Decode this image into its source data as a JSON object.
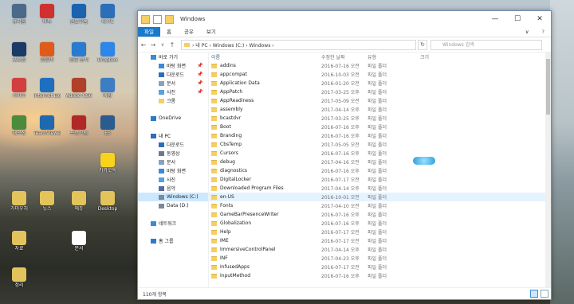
{
  "desktop": {
    "icons": [
      {
        "label": "휴지통",
        "color": "#4a6a8a"
      },
      {
        "label": "바둑",
        "color": "#d03030"
      },
      {
        "label": "윈도우홈",
        "color": "#1a63b0"
      },
      {
        "label": "내 PC",
        "color": "#2a6fb8"
      },
      {
        "label": "포토샵",
        "color": "#1b3b67"
      },
      {
        "label": "알툴바",
        "color": "#e05a1c"
      },
      {
        "label": "한글 문서",
        "color": "#2a7bd0"
      },
      {
        "label": "Dropbox",
        "color": "#2d86e8"
      },
      {
        "label": "카카오",
        "color": "#d23f3f"
      },
      {
        "label": "Internet Explorer",
        "color": "#1f6fc0"
      },
      {
        "label": "Adobe CS6",
        "color": "#b0402a"
      },
      {
        "label": "바탕",
        "color": "#3c7ec3"
      },
      {
        "label": "메모장",
        "color": "#4b8b3b"
      },
      {
        "label": "TeamViewer",
        "color": "#1f69b1"
      },
      {
        "label": "프로그램",
        "color": "#b02828"
      },
      {
        "label": "ES",
        "color": "#2a5c90"
      },
      {
        "label": "카카오톡",
        "color": "#f7d31d"
      },
      {
        "label": "가미우치",
        "color": "#e3c35c"
      },
      {
        "label": "뉴스",
        "color": "#e3c35c"
      },
      {
        "label": "에듀",
        "color": "#e3c35c"
      },
      {
        "label": "Desktop",
        "color": "#e3c35c"
      },
      {
        "label": "자료",
        "color": "#e3c35c"
      },
      {
        "label": "문서",
        "color": "#ffffff"
      },
      {
        "label": "정리",
        "color": "#e3c35c"
      }
    ]
  },
  "window": {
    "title": "Windows",
    "minimize_label": "—",
    "maximize_label": "☐",
    "close_label": "✕",
    "ribbon_tabs": [
      "파일",
      "홈",
      "공유",
      "보기"
    ],
    "expand_ribbon": "∨",
    "help": "?",
    "nav": {
      "back": "←",
      "forward": "→",
      "up": "↑",
      "recent": "∨"
    },
    "address_path": "›  내 PC  ›  Windows (C:)  ›  Windows  ›",
    "refresh": "↻",
    "search_placeholder": "Windows 검색",
    "navpane": {
      "items": [
        {
          "label": "바로 가기",
          "indent": 2,
          "pin": false,
          "icon": "#3a8ad6",
          "sel": false
        },
        {
          "label": "바탕 화면",
          "indent": 12,
          "pin": true,
          "icon": "#3a8ad6",
          "sel": false
        },
        {
          "label": "다운로드",
          "indent": 12,
          "pin": true,
          "icon": "#2a6fb8",
          "sel": false
        },
        {
          "label": "문서",
          "indent": 12,
          "pin": true,
          "icon": "#8aa0b8",
          "sel": false
        },
        {
          "label": "사진",
          "indent": 12,
          "pin": true,
          "icon": "#5aa0d8",
          "sel": false
        },
        {
          "label": "크롬",
          "indent": 12,
          "pin": false,
          "icon": "#f5cf64",
          "sel": false
        },
        {
          "label": "",
          "indent": 0,
          "pin": false,
          "icon": "",
          "sel": false
        },
        {
          "label": "OneDrive",
          "indent": 2,
          "pin": false,
          "icon": "#2a7bd0",
          "sel": false
        },
        {
          "label": "",
          "indent": 0,
          "pin": false,
          "icon": "",
          "sel": false
        },
        {
          "label": "내 PC",
          "indent": 2,
          "pin": false,
          "icon": "#2a6fb8",
          "sel": false
        },
        {
          "label": "다운로드",
          "indent": 12,
          "pin": false,
          "icon": "#2a6fb8",
          "sel": false
        },
        {
          "label": "동영상",
          "indent": 12,
          "pin": false,
          "icon": "#6a7a8a",
          "sel": false
        },
        {
          "label": "문서",
          "indent": 12,
          "pin": false,
          "icon": "#8aa0b8",
          "sel": false
        },
        {
          "label": "바탕 화면",
          "indent": 12,
          "pin": false,
          "icon": "#3a8ad6",
          "sel": false
        },
        {
          "label": "사진",
          "indent": 12,
          "pin": false,
          "icon": "#5aa0d8",
          "sel": false
        },
        {
          "label": "음악",
          "indent": 12,
          "pin": false,
          "icon": "#5a6a9a",
          "sel": false
        },
        {
          "label": "Windows (C:)",
          "indent": 12,
          "pin": false,
          "icon": "#7a8a9a",
          "sel": true
        },
        {
          "label": "Data (D:)",
          "indent": 12,
          "pin": false,
          "icon": "#7a8a9a",
          "sel": false
        },
        {
          "label": "",
          "indent": 0,
          "pin": false,
          "icon": "",
          "sel": false
        },
        {
          "label": "네트워크",
          "indent": 2,
          "pin": false,
          "icon": "#3a8ad6",
          "sel": false
        },
        {
          "label": "",
          "indent": 0,
          "pin": false,
          "icon": "",
          "sel": false
        },
        {
          "label": "홈 그룹",
          "indent": 2,
          "pin": false,
          "icon": "#2a7bd0",
          "sel": false
        }
      ]
    },
    "columns": {
      "name": "이름",
      "date": "수정한 날짜",
      "type": "유형",
      "size": "크기"
    },
    "files": [
      {
        "name": "addins",
        "date": "2016-07-16 오전",
        "type": "파일 폴더"
      },
      {
        "name": "appcompat",
        "date": "2016-10-03 오전",
        "type": "파일 폴더"
      },
      {
        "name": "Application Data",
        "date": "2016-01-20 오전",
        "type": "파일 폴더"
      },
      {
        "name": "AppPatch",
        "date": "2017-03-25 오후",
        "type": "파일 폴더"
      },
      {
        "name": "AppReadiness",
        "date": "2017-05-09 오전",
        "type": "파일 폴더"
      },
      {
        "name": "assembly",
        "date": "2017-04-14 오후",
        "type": "파일 폴더"
      },
      {
        "name": "bcastdvr",
        "date": "2017-03-25 오후",
        "type": "파일 폴더"
      },
      {
        "name": "Boot",
        "date": "2016-07-16 오후",
        "type": "파일 폴더"
      },
      {
        "name": "Branding",
        "date": "2016-07-16 오후",
        "type": "파일 폴더"
      },
      {
        "name": "CbsTemp",
        "date": "2017-05-05 오전",
        "type": "파일 폴더"
      },
      {
        "name": "Cursors",
        "date": "2016-07-16 오후",
        "type": "파일 폴더"
      },
      {
        "name": "debug",
        "date": "2017-04-16 오전",
        "type": "파일 폴더"
      },
      {
        "name": "diagnostics",
        "date": "2016-07-16 오후",
        "type": "파일 폴더"
      },
      {
        "name": "DigitalLocker",
        "date": "2016-07-17 오전",
        "type": "파일 폴더"
      },
      {
        "name": "Downloaded Program Files",
        "date": "2017-04-14 오후",
        "type": "파일 폴더"
      },
      {
        "name": "en-US",
        "date": "2016-10-01 오전",
        "type": "파일 폴더"
      },
      {
        "name": "Fonts",
        "date": "2017-04-10 오전",
        "type": "파일 폴더"
      },
      {
        "name": "GameBarPresenceWriter",
        "date": "2016-07-16 오후",
        "type": "파일 폴더"
      },
      {
        "name": "Globalization",
        "date": "2016-07-16 오후",
        "type": "파일 폴더"
      },
      {
        "name": "Help",
        "date": "2016-07-17 오전",
        "type": "파일 폴더"
      },
      {
        "name": "IME",
        "date": "2016-07-17 오전",
        "type": "파일 폴더"
      },
      {
        "name": "ImmersiveControlPanel",
        "date": "2017-04-14 오후",
        "type": "파일 폴더"
      },
      {
        "name": "INF",
        "date": "2017-04-23 오후",
        "type": "파일 폴더"
      },
      {
        "name": "InfusedApps",
        "date": "2016-07-17 오전",
        "type": "파일 폴더"
      },
      {
        "name": "InputMethod",
        "date": "2016-07-16 오후",
        "type": "파일 폴더"
      }
    ],
    "selected_row": 15,
    "status": "110개 항목"
  }
}
